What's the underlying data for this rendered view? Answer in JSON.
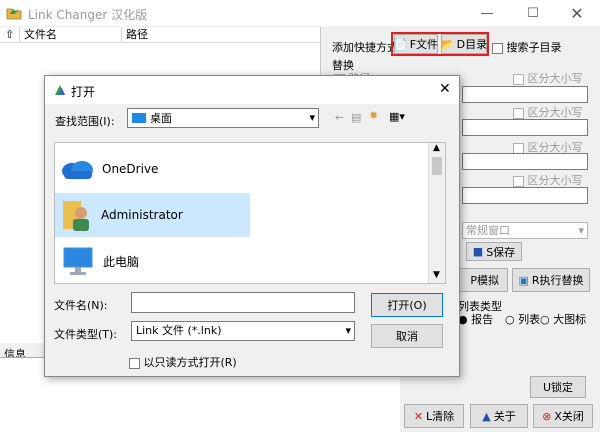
{
  "app": {
    "title": "Link Changer 汉化版",
    "list_headers": [
      "文件名",
      "路径"
    ],
    "add_shortcut_label": "添加快捷方式",
    "add_file_button": "F文件",
    "add_dir_button": "D目录",
    "search_subdir_label": "搜索子目录",
    "replace_section_label": "替换",
    "path_checkbox_label": "路径",
    "case_sensitive_label": "区分大小写",
    "window_mode_value": "常规窗口",
    "save_button": "S保存",
    "simulate_button": "P模拟",
    "execute_button": "R执行替换",
    "list_type_label": "列表类型",
    "list_type_options": [
      "报告",
      "列表",
      "大图标"
    ],
    "info_label": "信息",
    "clear_button": "L清除",
    "about_button": "关于",
    "close_button": "X关闭",
    "lock_button": "U锁定"
  },
  "dialog": {
    "title": "打开",
    "look_in_label": "查找范围(I):",
    "look_in_value": "桌面",
    "places": [
      "OneDrive",
      "Administrator",
      "此电脑"
    ],
    "filename_label": "文件名(N):",
    "filename_value": "",
    "filetype_label": "文件类型(T):",
    "filetype_value": "Link 文件 (*.lnk)",
    "open_button": "打开(O)",
    "cancel_button": "取消",
    "readonly_label": "以只读方式打开(R)"
  },
  "colors": {
    "highlight": "#e02020",
    "selection": "#cce8ff",
    "accent": "#0078d7"
  }
}
